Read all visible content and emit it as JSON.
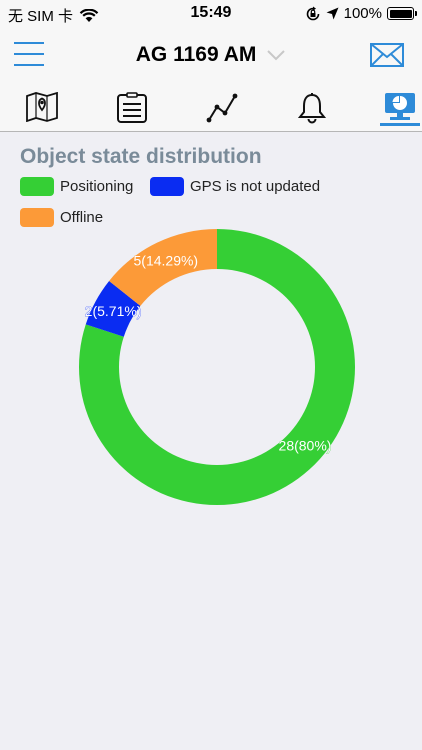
{
  "status_bar": {
    "carrier": "无 SIM 卡",
    "time": "15:49",
    "battery": "100%"
  },
  "nav": {
    "title": "AG 1169 AM"
  },
  "tabs": [
    {
      "icon": "map-icon"
    },
    {
      "icon": "list-icon"
    },
    {
      "icon": "track-icon"
    },
    {
      "icon": "bell-icon"
    },
    {
      "icon": "statistics-icon",
      "active": true
    }
  ],
  "chart_data": {
    "type": "pie",
    "title": "Object state distribution",
    "slices": [
      {
        "name": "Positioning",
        "value": 28,
        "label": "28(80%)",
        "color": "#35cf35"
      },
      {
        "name": "GPS is not updated",
        "value": 2,
        "label": "2(5.71%)",
        "color": "#0a2cf2"
      },
      {
        "name": "Offline",
        "value": 5,
        "label": "5(14.29%)",
        "color": "#fc9a38"
      }
    ],
    "legend_position": "top"
  }
}
